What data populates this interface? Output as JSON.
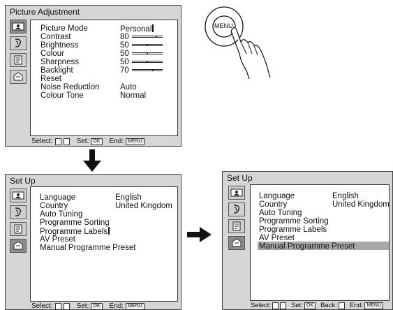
{
  "picture": {
    "title": "Picture Adjustment",
    "items": [
      {
        "label": "Picture Mode",
        "value": "Personal"
      },
      {
        "label": "Contrast",
        "value": "80",
        "level": 0.8
      },
      {
        "label": "Brightness",
        "value": "50",
        "level": 0.5
      },
      {
        "label": "Colour",
        "value": "50",
        "level": 0.5
      },
      {
        "label": "Sharpness",
        "value": "50",
        "level": 0.5
      },
      {
        "label": "Backlight",
        "value": "70",
        "level": 0.7
      },
      {
        "label": "Reset",
        "value": ""
      },
      {
        "label": "Noise Reduction",
        "value": "Auto"
      },
      {
        "label": "Colour Tone",
        "value": "Normal"
      }
    ],
    "footer": {
      "select": "Select:",
      "set": "Set:",
      "ok": "OK",
      "end": "End:",
      "menu": "MENU"
    }
  },
  "remote": {
    "button": "MENU"
  },
  "setup1": {
    "title": "Set Up",
    "items": [
      {
        "label": "Language",
        "value": "English"
      },
      {
        "label": "Country",
        "value": "United Kingdom"
      },
      {
        "label": "Auto Tuning",
        "value": ""
      },
      {
        "label": "Programme Sorting",
        "value": ""
      },
      {
        "label": "Programme Labels",
        "value": ""
      },
      {
        "label": "AV Preset",
        "value": ""
      },
      {
        "label": "Manual Programme Preset",
        "value": ""
      }
    ],
    "footer": {
      "select": "Select:",
      "set": "Set:",
      "ok": "OK",
      "end": "End:",
      "menu": "MENU"
    }
  },
  "setup2": {
    "title": "Set Up",
    "items": [
      {
        "label": "Language",
        "value": "English"
      },
      {
        "label": "Country",
        "value": "United Kingdom"
      },
      {
        "label": "Auto Tuning",
        "value": ""
      },
      {
        "label": "Programme Sorting",
        "value": ""
      },
      {
        "label": "Programme Labels",
        "value": ""
      },
      {
        "label": "AV Preset",
        "value": ""
      },
      {
        "label": "Manual Programme Preset",
        "value": ""
      }
    ],
    "highlighted": "Manual Programme Preset",
    "footer": {
      "select": "Select:",
      "set": "Set:",
      "ok": "OK",
      "back": "Back:",
      "end": "End:",
      "menu": "MENU"
    }
  },
  "icons": [
    "picture-icon",
    "sound-icon",
    "features-icon",
    "setup-icon"
  ]
}
